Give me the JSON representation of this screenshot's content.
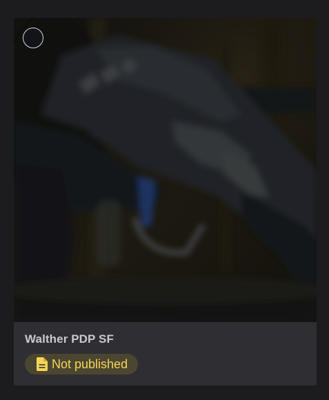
{
  "card": {
    "title": "Walther PDP SF",
    "status_label": "Not published",
    "status_icon": "file-document-icon",
    "selection_icon": "select-circle-icon",
    "colors": {
      "card_bg": "#2e2e33",
      "badge_bg": "#4b4630",
      "badge_text": "#f5d55a",
      "title_text": "#c9c9d0"
    }
  }
}
